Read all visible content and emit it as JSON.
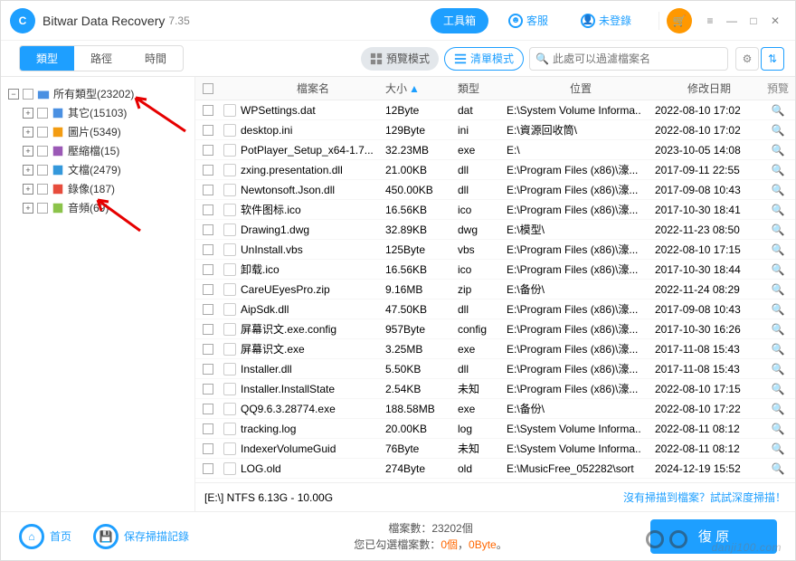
{
  "titlebar": {
    "app_name": "Bitwar Data Recovery",
    "version": "7.35",
    "toolbox": "工具箱",
    "support": "客服",
    "login": "未登錄"
  },
  "toolbar": {
    "tabs": [
      "類型",
      "路徑",
      "時間"
    ],
    "active_tab": 0,
    "preview_mode": "預覽模式",
    "list_mode": "清單模式",
    "search_placeholder": "此處可以過濾檔案名"
  },
  "sidebar": {
    "root": "所有類型(23202)",
    "items": [
      {
        "label": "其它(15103)",
        "color": "#4a90e2"
      },
      {
        "label": "圖片(5349)",
        "color": "#f39c12"
      },
      {
        "label": "壓縮檔(15)",
        "color": "#9b59b6"
      },
      {
        "label": "文檔(2479)",
        "color": "#3498db"
      },
      {
        "label": "錄像(187)",
        "color": "#e74c3c"
      },
      {
        "label": "音頻(69)",
        "color": "#8bc34a"
      }
    ]
  },
  "table": {
    "headers": {
      "name": "檔案名",
      "size": "大小",
      "type": "類型",
      "location": "位置",
      "date": "修改日期",
      "preview": "預覽"
    },
    "rows": [
      {
        "name": "WPSettings.dat",
        "size": "12Byte",
        "type": "dat",
        "loc": "E:\\System Volume Informa..",
        "date": "2022-08-10 17:02"
      },
      {
        "name": "desktop.ini",
        "size": "129Byte",
        "type": "ini",
        "loc": "E:\\資源回收筒\\",
        "date": "2022-08-10 17:02"
      },
      {
        "name": "PotPlayer_Setup_x64-1.7...",
        "size": "32.23MB",
        "type": "exe",
        "loc": "E:\\",
        "date": "2023-10-05 14:08"
      },
      {
        "name": "zxing.presentation.dll",
        "size": "21.00KB",
        "type": "dll",
        "loc": "E:\\Program Files (x86)\\濠...",
        "date": "2017-09-11 22:55"
      },
      {
        "name": "Newtonsoft.Json.dll",
        "size": "450.00KB",
        "type": "dll",
        "loc": "E:\\Program Files (x86)\\濠...",
        "date": "2017-09-08 10:43"
      },
      {
        "name": "软件图标.ico",
        "size": "16.56KB",
        "type": "ico",
        "loc": "E:\\Program Files (x86)\\濠...",
        "date": "2017-10-30 18:41"
      },
      {
        "name": "Drawing1.dwg",
        "size": "32.89KB",
        "type": "dwg",
        "loc": "E:\\模型\\",
        "date": "2022-11-23 08:50"
      },
      {
        "name": "UnInstall.vbs",
        "size": "125Byte",
        "type": "vbs",
        "loc": "E:\\Program Files (x86)\\濠...",
        "date": "2022-08-10 17:15"
      },
      {
        "name": "卸载.ico",
        "size": "16.56KB",
        "type": "ico",
        "loc": "E:\\Program Files (x86)\\濠...",
        "date": "2017-10-30 18:44"
      },
      {
        "name": "CareUEyesPro.zip",
        "size": "9.16MB",
        "type": "zip",
        "loc": "E:\\备份\\",
        "date": "2022-11-24 08:29"
      },
      {
        "name": "AipSdk.dll",
        "size": "47.50KB",
        "type": "dll",
        "loc": "E:\\Program Files (x86)\\濠...",
        "date": "2017-09-08 10:43"
      },
      {
        "name": "屏幕识文.exe.config",
        "size": "957Byte",
        "type": "config",
        "loc": "E:\\Program Files (x86)\\濠...",
        "date": "2017-10-30 16:26"
      },
      {
        "name": "屏幕识文.exe",
        "size": "3.25MB",
        "type": "exe",
        "loc": "E:\\Program Files (x86)\\濠...",
        "date": "2017-11-08 15:43"
      },
      {
        "name": "Installer.dll",
        "size": "5.50KB",
        "type": "dll",
        "loc": "E:\\Program Files (x86)\\濠...",
        "date": "2017-11-08 15:43"
      },
      {
        "name": "Installer.InstallState",
        "size": "2.54KB",
        "type": "未知",
        "loc": "E:\\Program Files (x86)\\濠...",
        "date": "2022-08-10 17:15"
      },
      {
        "name": "QQ9.6.3.28774.exe",
        "size": "188.58MB",
        "type": "exe",
        "loc": "E:\\备份\\",
        "date": "2022-08-10 17:22"
      },
      {
        "name": "tracking.log",
        "size": "20.00KB",
        "type": "log",
        "loc": "E:\\System Volume Informa..",
        "date": "2022-08-11 08:12"
      },
      {
        "name": "IndexerVolumeGuid",
        "size": "76Byte",
        "type": "未知",
        "loc": "E:\\System Volume Informa..",
        "date": "2022-08-11 08:12"
      },
      {
        "name": "LOG.old",
        "size": "274Byte",
        "type": "old",
        "loc": "E:\\MusicFree_052282\\sort",
        "date": "2024-12-19 15:52"
      }
    ]
  },
  "drive": {
    "info": "[E:\\] NTFS 6.13G - 10.00G",
    "deep_scan": "沒有掃描到檔案？試試深度掃描！"
  },
  "footer": {
    "home": "首页",
    "save_scan": "保存掃描記錄",
    "file_count_label": "檔案數：",
    "file_count_value": "23202個",
    "selected_label": "您已勾選檔案數：",
    "selected_count": "0個",
    "sep": "，",
    "selected_size": "0Byte",
    "dot": "。",
    "recover": "復 原"
  },
  "watermark": "danji100.com"
}
